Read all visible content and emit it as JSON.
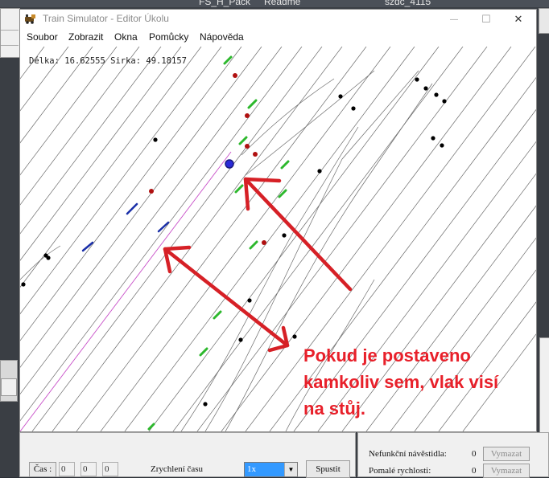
{
  "taskbar": {
    "item1": "FS_H_Pack",
    "item2": "Readme",
    "item3": "szdc_4115"
  },
  "window": {
    "title": "Train Simulator - Editor Úkolu",
    "icon": "train-app-icon",
    "minimize_glyph": "—",
    "maximize_glyph": "☐",
    "close_glyph": "✕"
  },
  "menu": {
    "items": [
      "Soubor",
      "Zobrazit",
      "Okna",
      "Pomůcky",
      "Nápověda"
    ]
  },
  "coords": {
    "text": "Délka: 16.62555 Sirka: 49.18157"
  },
  "annotation": {
    "text": "Pokud je postaveno kamkoliv sem, vlak visí na stůj.",
    "color": "#e8202a"
  },
  "bottom": {
    "time_label": "Čas :",
    "time_h": "0",
    "time_m": "0",
    "time_s": "0",
    "speed_label": "Zrychlení času",
    "speed_value": "1x",
    "start_button": "Spustit"
  },
  "status": {
    "row1_label": "Nefunkční návěstidla:",
    "row1_value": "0",
    "row1_button": "Vymazat",
    "row2_label": "Pomalé rychlosti:",
    "row2_value": "0",
    "row2_button": "Vymazat"
  },
  "colors": {
    "track": "#6b6b6b",
    "signal_green": "#2db82d",
    "signal_red": "#b01010",
    "blue_mark": "#1a2fa8",
    "selected": "#2a2ad8",
    "route": "#c84fc8"
  }
}
